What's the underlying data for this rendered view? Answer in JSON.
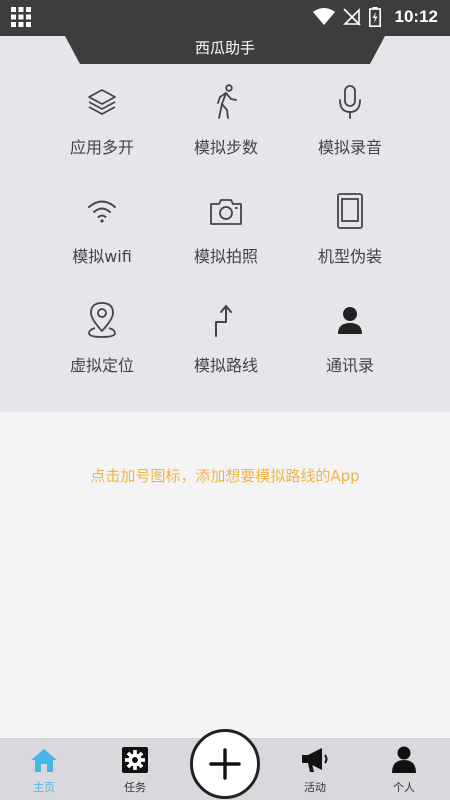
{
  "status_bar": {
    "time": "10:12",
    "icons": [
      "app-grid-icon",
      "wifi-icon",
      "no-sim-icon",
      "battery-charging-icon"
    ]
  },
  "header": {
    "title": "西瓜助手"
  },
  "features": [
    {
      "icon": "layers-icon",
      "label": "应用多开"
    },
    {
      "icon": "walking-icon",
      "label": "模拟步数"
    },
    {
      "icon": "microphone-icon",
      "label": "模拟录音"
    },
    {
      "icon": "wifi-icon",
      "label": "模拟wifi"
    },
    {
      "icon": "camera-icon",
      "label": "模拟拍照"
    },
    {
      "icon": "phone-device-icon",
      "label": "机型伪装"
    },
    {
      "icon": "location-pin-icon",
      "label": "虚拟定位"
    },
    {
      "icon": "route-arrow-icon",
      "label": "模拟路线"
    },
    {
      "icon": "contact-person-icon",
      "label": "通讯录"
    }
  ],
  "main": {
    "hint": "点击加号图标，添加想要模拟路线的App"
  },
  "bottom_nav": {
    "items": [
      {
        "icon": "home-icon",
        "label": "主页",
        "active": true
      },
      {
        "icon": "gear-icon",
        "label": "任务",
        "active": false
      },
      {
        "icon": "plus-icon",
        "label": "",
        "active": false
      },
      {
        "icon": "megaphone-icon",
        "label": "活动",
        "active": false
      },
      {
        "icon": "user-icon",
        "label": "个人",
        "active": false
      }
    ]
  },
  "colors": {
    "status_bar": "#3d3d3d",
    "panel_bg": "#e6e6ea",
    "hint_text": "#f0b441",
    "active_tab": "#46b6e6",
    "icon_stroke": "#444444"
  }
}
